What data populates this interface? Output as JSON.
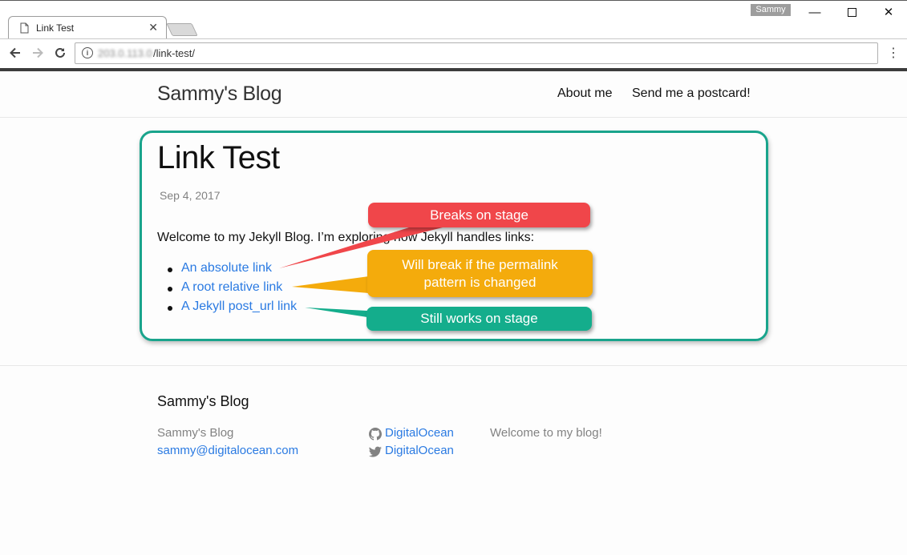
{
  "browser": {
    "tab_title": "Link Test",
    "profile_name": "Sammy",
    "url_host": "203.0.113.0",
    "url_path": "/link-test/",
    "icons": [
      "page-icon",
      "close-icon",
      "back-arrow-icon",
      "forward-arrow-icon",
      "reload-icon",
      "info-icon",
      "more-vert-icon",
      "minimize-icon",
      "maximize-icon"
    ]
  },
  "site": {
    "title": "Sammy's Blog",
    "nav": [
      "About me",
      "Send me a postcard!"
    ]
  },
  "post": {
    "title": "Link Test",
    "date": "Sep 4, 2017",
    "intro": "Welcome to my Jekyll Blog. I’m exploring how Jekyll handles links:",
    "links": [
      "An absolute link",
      "A root relative link",
      "A Jekyll post_url link"
    ]
  },
  "annotations": {
    "breaks": "Breaks on stage",
    "will_break_line1": "Will break if the permalink",
    "will_break_line2": "pattern is changed",
    "works": "Still works on stage",
    "colors": {
      "red": "#f0464a",
      "yellow": "#f4ab0c",
      "green": "#14ad8c",
      "frame": "#19a48c"
    }
  },
  "footer": {
    "heading": "Sammy's Blog",
    "name": "Sammy's Blog",
    "email": "sammy@digitalocean.com",
    "github": "DigitalOcean",
    "twitter": "DigitalOcean",
    "description": "Welcome to my blog!"
  }
}
